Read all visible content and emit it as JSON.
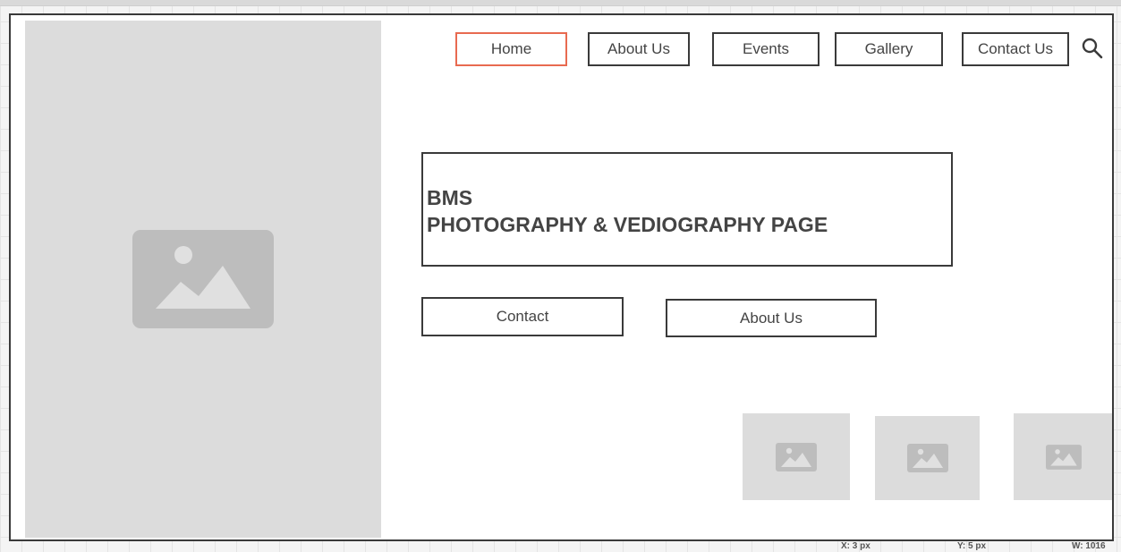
{
  "nav": {
    "home": "Home",
    "about": "About Us",
    "events": "Events",
    "gallery": "Gallery",
    "contact": "Contact Us",
    "active_color": "#e86a50"
  },
  "hero": {
    "title_line1": "BMS",
    "title_line2": "PHOTOGRAPHY & VEDIOGRAPHY PAGE"
  },
  "cta": {
    "contact": "Contact",
    "about": "About Us"
  },
  "icons": {
    "search": "search-icon",
    "image_placeholder": "image-icon"
  },
  "status_bar": {
    "x": "X: 3 px",
    "y": "Y: 5 px",
    "w": "W: 1016"
  },
  "colors": {
    "placeholder_bg": "#dcdcdc",
    "placeholder_icon": "#bdbdbd",
    "border": "#3a3a3a",
    "text": "#444444"
  }
}
